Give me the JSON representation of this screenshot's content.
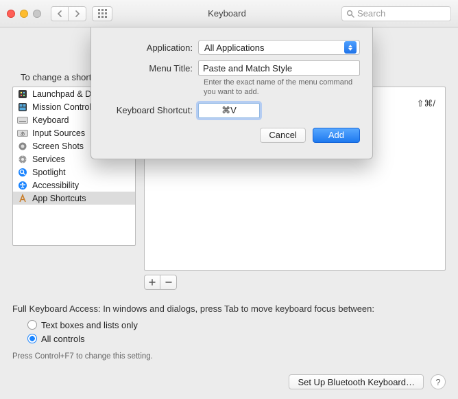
{
  "window": {
    "title": "Keyboard",
    "search_placeholder": "Search"
  },
  "lead_text": "To change a shortcut, select it, click the key combination, and then type the new keys.",
  "sidebar": {
    "items": [
      {
        "label": "Launchpad & Dock",
        "icon": "launchpad-icon"
      },
      {
        "label": "Mission Control",
        "icon": "mission-control-icon"
      },
      {
        "label": "Keyboard",
        "icon": "keyboard-icon"
      },
      {
        "label": "Input Sources",
        "icon": "input-sources-icon"
      },
      {
        "label": "Screen Shots",
        "icon": "screenshots-icon"
      },
      {
        "label": "Services",
        "icon": "services-icon"
      },
      {
        "label": "Spotlight",
        "icon": "spotlight-icon"
      },
      {
        "label": "Accessibility",
        "icon": "accessibility-icon"
      },
      {
        "label": "App Shortcuts",
        "icon": "app-shortcuts-icon"
      }
    ],
    "selected_index": 8
  },
  "detail": {
    "shortcut_display": "⇧⌘/"
  },
  "fka": {
    "heading": "Full Keyboard Access: In windows and dialogs, press Tab to move keyboard focus between:",
    "options": [
      "Text boxes and lists only",
      "All controls"
    ],
    "selected_index": 1,
    "hint": "Press Control+F7 to change this setting."
  },
  "footer": {
    "bluetooth_btn": "Set Up Bluetooth Keyboard…"
  },
  "sheet": {
    "labels": {
      "application": "Application:",
      "menu_title": "Menu Title:",
      "shortcut": "Keyboard Shortcut:"
    },
    "application_value": "All Applications",
    "menu_title_value": "Paste and Match Style",
    "menu_help": "Enter the exact name of the menu command you want to add.",
    "shortcut_value": "⌘V",
    "buttons": {
      "cancel": "Cancel",
      "add": "Add"
    }
  }
}
